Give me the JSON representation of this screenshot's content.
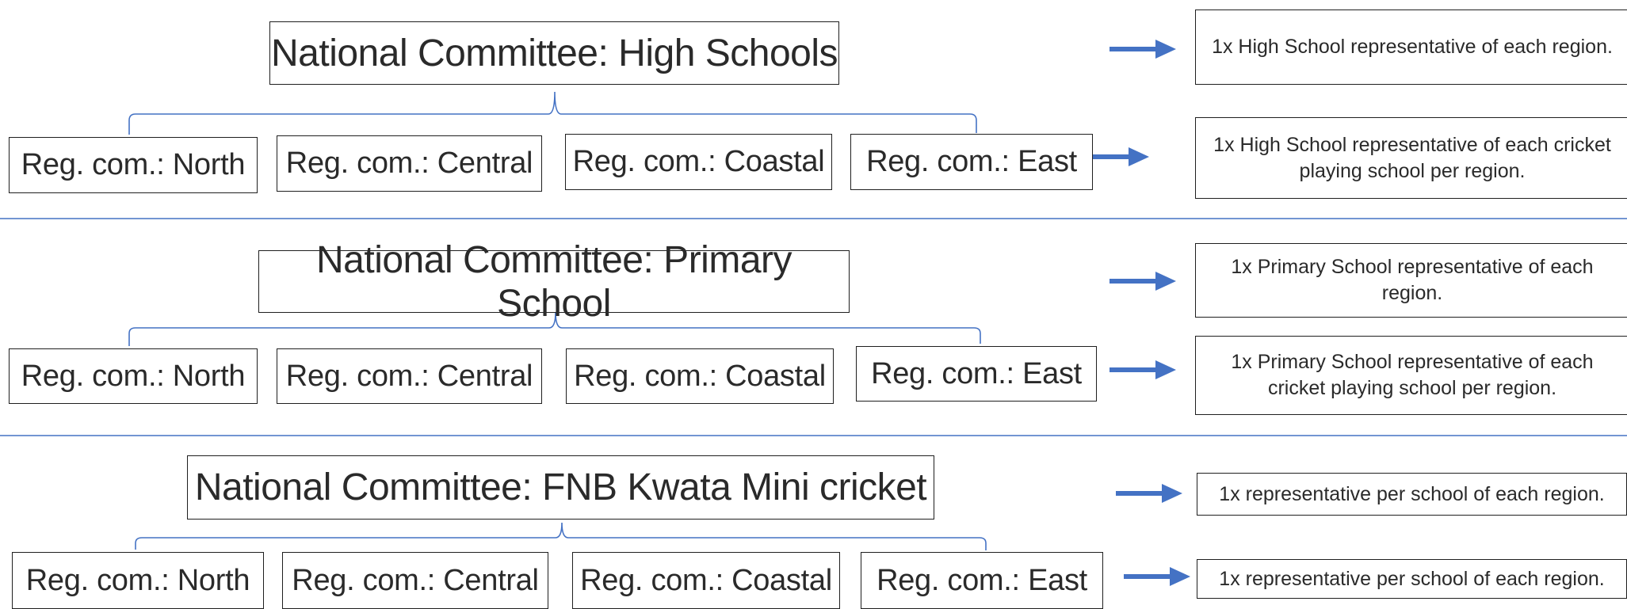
{
  "colors": {
    "arrow": "#4472c4",
    "bracket": "#4472c4",
    "divider": "#4472c4",
    "box_border": "#1f1f1f"
  },
  "sections": [
    {
      "national": "National Committee: High Schools",
      "regions": [
        "Reg. com.: North",
        "Reg. com.: Central",
        "Reg. com.: Coastal",
        "Reg. com.: East"
      ],
      "note_national": "1x High School representative of each region.",
      "note_regional": "1x High School representative of each cricket playing school per region."
    },
    {
      "national": "National Committee: Primary School",
      "regions": [
        "Reg. com.: North",
        "Reg. com.: Central",
        "Reg. com.: Coastal",
        "Reg. com.: East"
      ],
      "note_national": "1x Primary School representative of each region.",
      "note_regional": "1x Primary School representative of each cricket playing school per region."
    },
    {
      "national": "National Committee: FNB Kwata Mini cricket",
      "regions": [
        "Reg. com.: North",
        "Reg. com.: Central",
        "Reg. com.: Coastal",
        "Reg. com.: East"
      ],
      "note_national": "1x representative per school of each region.",
      "note_regional": "1x representative per school of each region."
    }
  ]
}
